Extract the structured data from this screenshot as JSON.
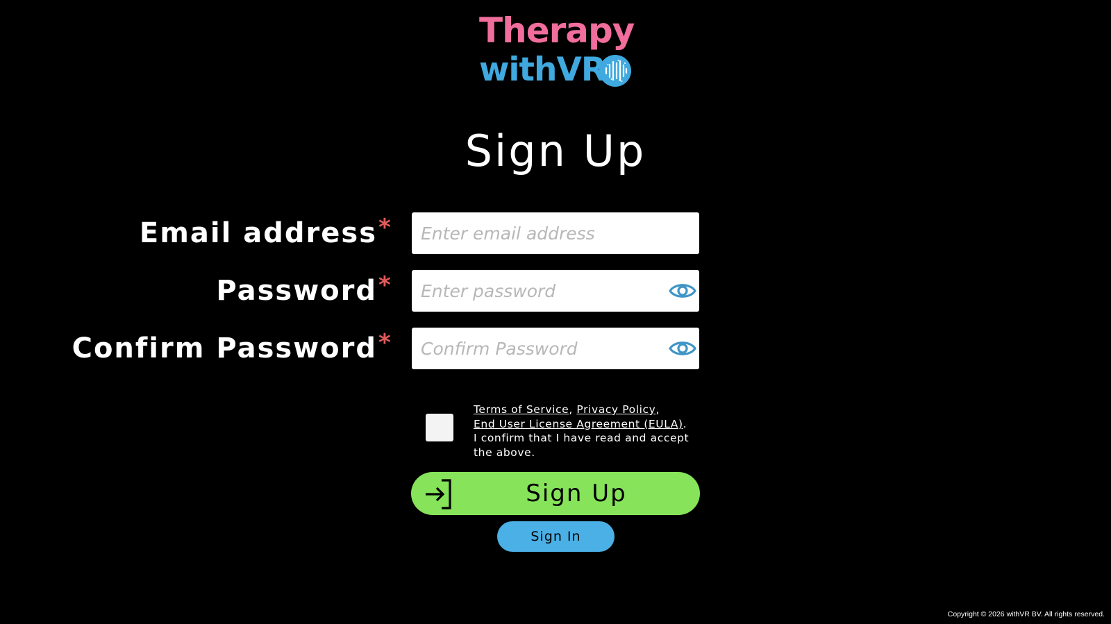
{
  "logo": {
    "line1": "Therapy",
    "line2": "withVR",
    "badge_icon": "vr-soundwave-icon",
    "colors": {
      "therapy": "#f06d9c",
      "withvr": "#3fa9e0"
    }
  },
  "title": "Sign Up",
  "form": {
    "email": {
      "label": "Email address",
      "required_mark": "*",
      "placeholder": "Enter email address",
      "value": ""
    },
    "password": {
      "label": "Password",
      "required_mark": "*",
      "placeholder": "Enter password",
      "value": "",
      "toggle_icon": "eye-icon"
    },
    "confirm_password": {
      "label": "Confirm Password",
      "required_mark": "*",
      "placeholder": "Confirm Password",
      "value": "",
      "toggle_icon": "eye-icon"
    }
  },
  "terms": {
    "checked": false,
    "tos_link": "Terms of Service",
    "sep1": ", ",
    "privacy_link": "Privacy Policy",
    "sep2": ",",
    "eula_link": "End User License Agreement (EULA)",
    "sep3": ".",
    "confirm_text": "I confirm that I have read and accept the above."
  },
  "buttons": {
    "signup_label": "Sign Up",
    "signup_icon": "sign-in-arrow-icon",
    "signup_color": "#86e35a",
    "signin_label": "Sign In",
    "signin_color": "#4bb0e6"
  },
  "footer": {
    "copyright": "Copyright © 2026 withVR BV. All rights reserved."
  },
  "colors": {
    "background": "#000000",
    "required": "#e25a5a",
    "accent_blue": "#3f95c6"
  }
}
